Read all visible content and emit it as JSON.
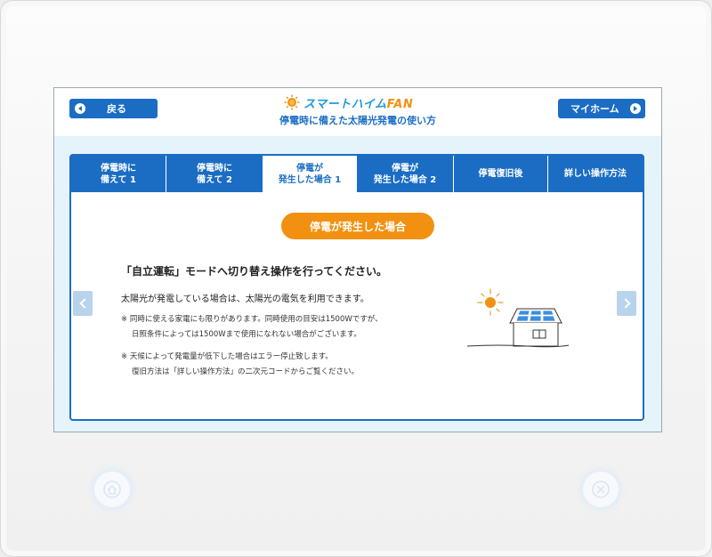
{
  "header": {
    "back_label": "戻る",
    "home_label": "マイホーム",
    "logo_main": "スマートハイム",
    "logo_fan": "FAN",
    "subtitle": "停電時に備えた太陽光発電の使い方"
  },
  "tabs": [
    {
      "label": "停電時に\n備えて 1"
    },
    {
      "label": "停電時に\n備えて 2"
    },
    {
      "label": "停電が\n発生した場合 1"
    },
    {
      "label": "停電が\n発生した場合 2"
    },
    {
      "label": "停電復旧後"
    },
    {
      "label": "詳しい操作方法"
    }
  ],
  "content": {
    "section_title": "停電が発生した場合",
    "heading": "「自立運転」モードへ切り替え操作を行ってください。",
    "main_text": "太陽光が発電している場合は、太陽光の電気を利用できます。",
    "note1_line1": "※ 同時に使える家電にも限りがあります。同時使用の目安は1500Wですが、",
    "note1_line2": "日照条件によっては1500Wまで使用になれない場合がございます。",
    "note2_line1": "※ 天候によって発電量が低下した場合はエラー停止致します。",
    "note2_line2": "復旧方法は「詳しい操作方法」の二次元コードからご覧ください。"
  },
  "colors": {
    "primary_blue": "#1b6dc4",
    "orange": "#f29111",
    "screen_bg": "#e5f3fb"
  },
  "icons": [
    "back-arrow-icon",
    "home-arrow-icon",
    "sun-logo-icon",
    "prev-chevron-icon",
    "next-chevron-icon",
    "solar-house-illustration",
    "home-hardware-icon",
    "close-hardware-icon"
  ]
}
